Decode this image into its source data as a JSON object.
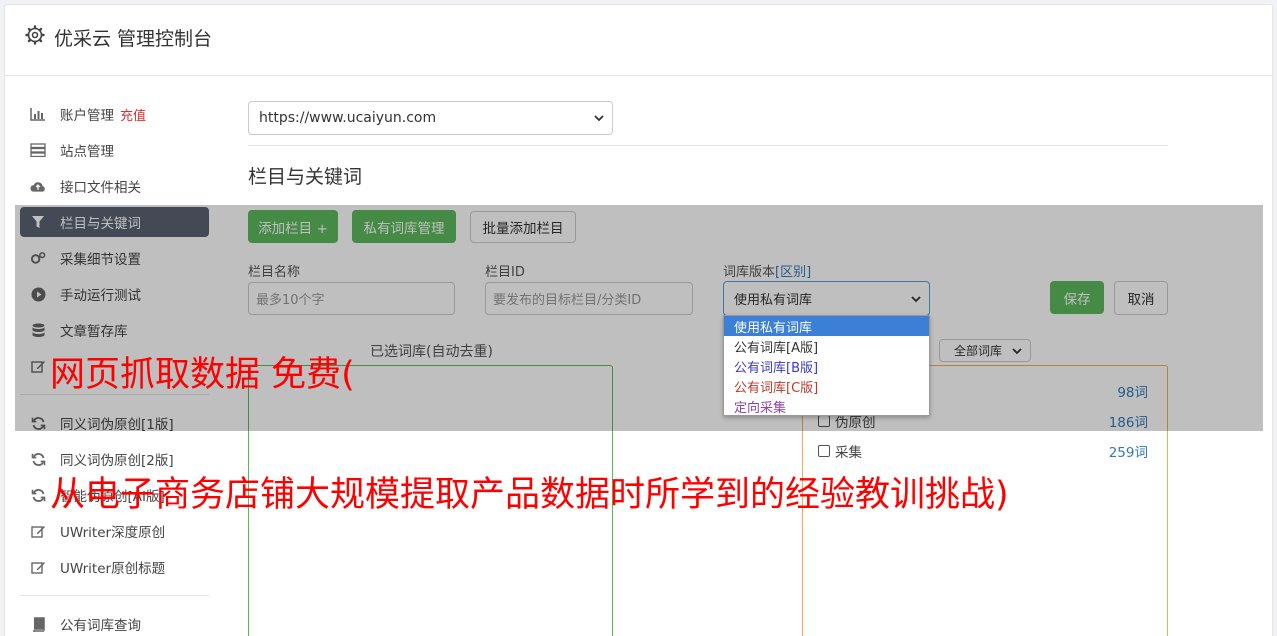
{
  "header": {
    "title": "优采云 管理控制台"
  },
  "sidebar": {
    "items": [
      {
        "label": "账户管理",
        "extra": "充值",
        "icon": "bar-chart-icon"
      },
      {
        "label": "站点管理",
        "icon": "server-icon"
      },
      {
        "label": "接口文件相关",
        "icon": "cloud-upload-icon"
      },
      {
        "label": "栏目与关键词",
        "icon": "filter-icon"
      },
      {
        "label": "采集细节设置",
        "icon": "gears-icon"
      },
      {
        "label": "手动运行测试",
        "icon": "play-circle-icon"
      },
      {
        "label": "文章暂存库",
        "icon": "database-icon"
      },
      {
        "label": "同义词伪原创[1版]",
        "icon": "refresh-icon"
      },
      {
        "label": "同义词伪原创[2版]",
        "icon": "refresh-icon"
      },
      {
        "label": "智能伪原创[AI版]",
        "icon": "refresh-icon"
      },
      {
        "label": "UWriter深度原创",
        "icon": "edit-icon"
      },
      {
        "label": "UWriter原创标题",
        "icon": "edit-icon"
      },
      {
        "label": "公有词库查询",
        "icon": "book-icon"
      }
    ]
  },
  "main": {
    "site_select": "https://www.ucaiyun.com",
    "section_title": "栏目与关键词",
    "buttons": {
      "add_column": "添加栏目 +",
      "private_lib": "私有词库管理",
      "batch_add": "批量添加栏目",
      "save": "保存",
      "cancel": "取消"
    },
    "form": {
      "name_label": "栏目名称",
      "name_placeholder": "最多10个字",
      "id_label": "栏目ID",
      "id_placeholder": "要发布的目标栏目/分类ID",
      "version_label": "词库版本",
      "version_sub": "[区别]",
      "version_value": "使用私有词库"
    },
    "dropdown_options": [
      {
        "label": "使用私有词库",
        "color": "#ffffff"
      },
      {
        "label": "公有词库[A版]",
        "color": "#333333"
      },
      {
        "label": "公有词库[B版]",
        "color": "#3a3acc"
      },
      {
        "label": "公有词库[C版]",
        "color": "#c0392b"
      },
      {
        "label": "定向采集",
        "color": "#8e44ad"
      }
    ],
    "selected_label": "已选词库(自动去重)",
    "lib_filter": "全部词库",
    "libs": [
      {
        "label": "",
        "count": "98词"
      },
      {
        "label": "伪原创",
        "count": "186词"
      },
      {
        "label": "采集",
        "count": "259词"
      }
    ]
  },
  "banner": {
    "line1": "网页抓取数据 免费(",
    "line2": "从电子商务店铺大规模提取产品数据时所学到的经验教训挑战)"
  }
}
